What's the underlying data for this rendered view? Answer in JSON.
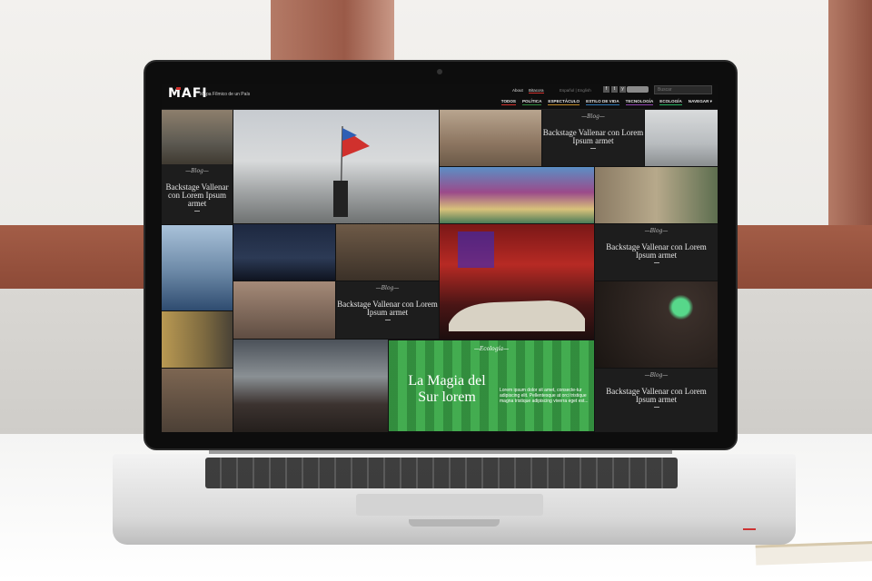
{
  "site": {
    "logo": "MAFI",
    "tagline": "Mapa Fílmico de un País",
    "top_links": [
      "About",
      "Bitacora"
    ],
    "language": "Español | English",
    "social": [
      "f",
      "t",
      "y"
    ],
    "search_placeholder": "Buscar"
  },
  "nav": {
    "items": [
      "TODOS",
      "POLÍTICA",
      "ESPECTÁCULO",
      "ESTILO DE VIDA",
      "TECNOLOGÍA",
      "ECOLOGÍA"
    ],
    "more": "NAVEGAR ▾"
  },
  "blog_cards": [
    {
      "category": "—Blog—",
      "title": "Backstage Vallenar con Lorem Ipsum armet"
    },
    {
      "category": "—Blog—",
      "title": "Backstage Vallenar con Lorem Ipsum armet"
    },
    {
      "category": "—Blog—",
      "title": "Backstage Vallenar con Lorem Ipsum armet"
    },
    {
      "category": "—Blog—",
      "title": "Backstage Vallenar con Lorem Ipsum armet"
    },
    {
      "category": "—Blog—",
      "title": "Backstage Vallenar con Lorem Ipsum armet"
    }
  ],
  "feature": {
    "category": "—Ecología—",
    "title": "La Magia del Sur lorem",
    "body": "Lorem ipsum dolor sit amet, consecte-tur adipiscing elit. Pellentesque at orci tristique magna tristique adipiscing viverra eget est..."
  },
  "colors": {
    "brand_red": "#d0312d",
    "ecologia_green": "#3ea84a"
  }
}
